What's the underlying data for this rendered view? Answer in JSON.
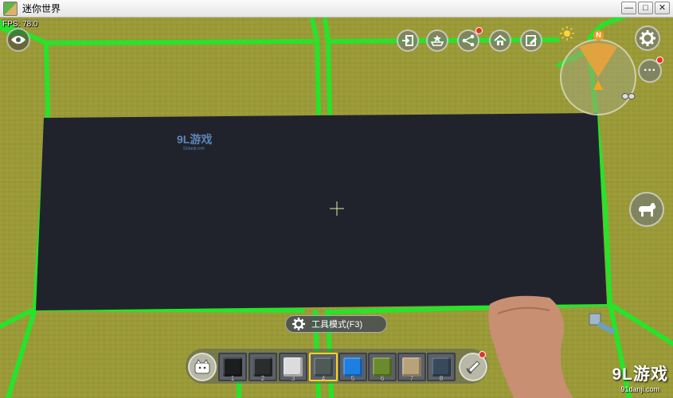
{
  "window": {
    "title": "迷你世界",
    "minimize_glyph": "—",
    "maximize_glyph": "□",
    "close_glyph": "✕"
  },
  "hud": {
    "fps": "FPS: 78.0",
    "top_icons": [
      "exit-icon",
      "shop-icon",
      "share-icon",
      "home-icon",
      "edit-note-icon"
    ],
    "compass_north": "N",
    "time_icon": "sun-icon",
    "settings_icon": "gear-icon",
    "more_glyph": "···",
    "pet_icon": "dog-icon",
    "view_icon": "eye-icon"
  },
  "tool_mode": {
    "label": "工具模式(F3)"
  },
  "hotbar": {
    "slots": [
      {
        "num": "1",
        "color": "#1b1d20"
      },
      {
        "num": "2",
        "color": "#2a2c2e"
      },
      {
        "num": "3",
        "color": "#dcdcdc"
      },
      {
        "num": "4",
        "color": "#4f5a58"
      },
      {
        "num": "5",
        "color": "#1f7fe0"
      },
      {
        "num": "6",
        "color": "#6b8a2c"
      },
      {
        "num": "7",
        "color": "#b7a27a"
      },
      {
        "num": "8",
        "color": "#39495c"
      }
    ],
    "selected": 4
  },
  "colors": {
    "grass": "#9b9a36",
    "grid_line": "#27e32a",
    "dark_slab": "#21232c",
    "hotbar_highlight": "#ffd21e"
  },
  "watermark": {
    "logo": "9L游戏",
    "url": "91danji.com"
  },
  "center_watermark": {
    "logo": "9L游戏",
    "url": "91danji.com"
  }
}
